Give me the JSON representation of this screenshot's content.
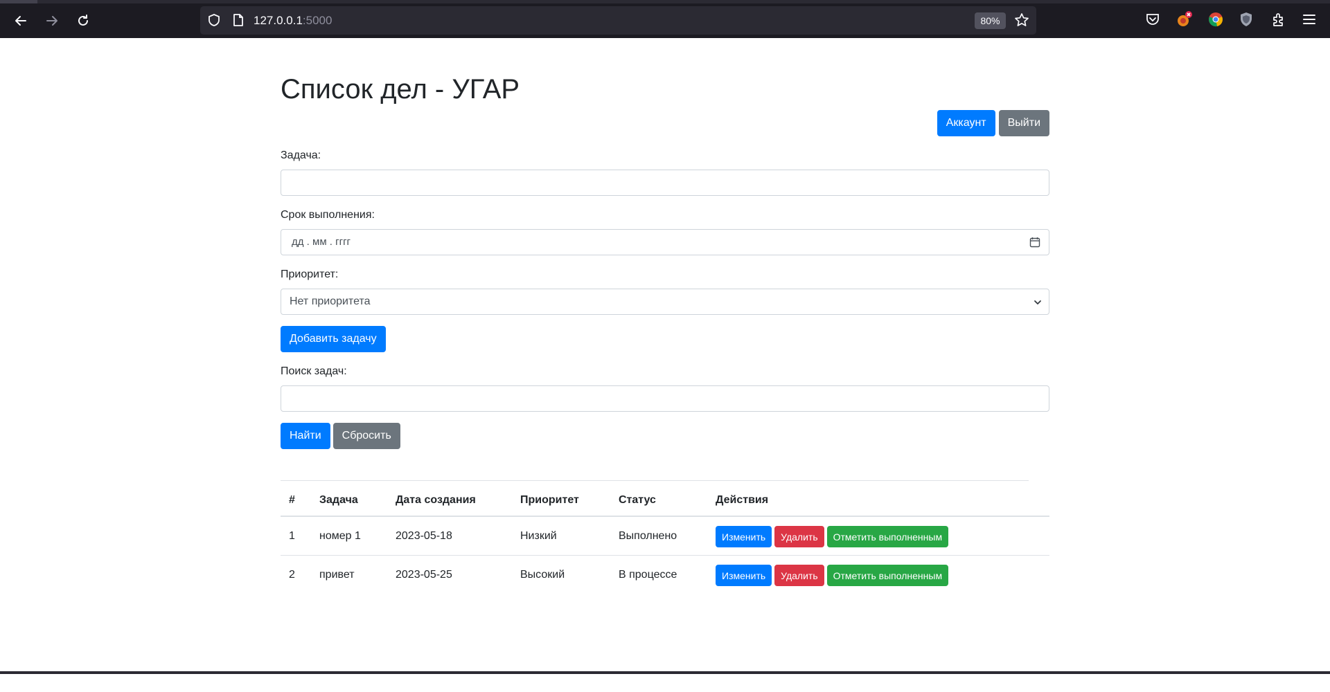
{
  "browser": {
    "url_host": "127.0.0.1",
    "url_port": ":5000",
    "zoom": "80%"
  },
  "page": {
    "title": "Список дел - УГАР",
    "account_button": "Аккаунт",
    "logout_button": "Выйти"
  },
  "form": {
    "task_label": "Задача:",
    "task_value": "",
    "due_label": "Срок выполнения:",
    "due_placeholder": "дд . мм . гггг",
    "priority_label": "Приоритет:",
    "priority_selected": "Нет приоритета",
    "add_button": "Добавить задачу"
  },
  "search": {
    "label": "Поиск задач:",
    "value": "",
    "find_button": "Найти",
    "reset_button": "Сбросить"
  },
  "table": {
    "headers": [
      "#",
      "Задача",
      "Дата создания",
      "Приоритет",
      "Статус",
      "Действия"
    ],
    "rows": [
      {
        "num": "1",
        "task": "номер 1",
        "created": "2023-05-18",
        "priority": "Низкий",
        "status": "Выполнено"
      },
      {
        "num": "2",
        "task": "привет",
        "created": "2023-05-25",
        "priority": "Высокий",
        "status": "В процессе"
      }
    ],
    "edit_label": "Изменить",
    "delete_label": "Удалить",
    "complete_label": "Отметить выполненным"
  },
  "colors": {
    "primary": "#007bff",
    "secondary": "#6c757d",
    "danger": "#dc3545",
    "success": "#28a745"
  }
}
